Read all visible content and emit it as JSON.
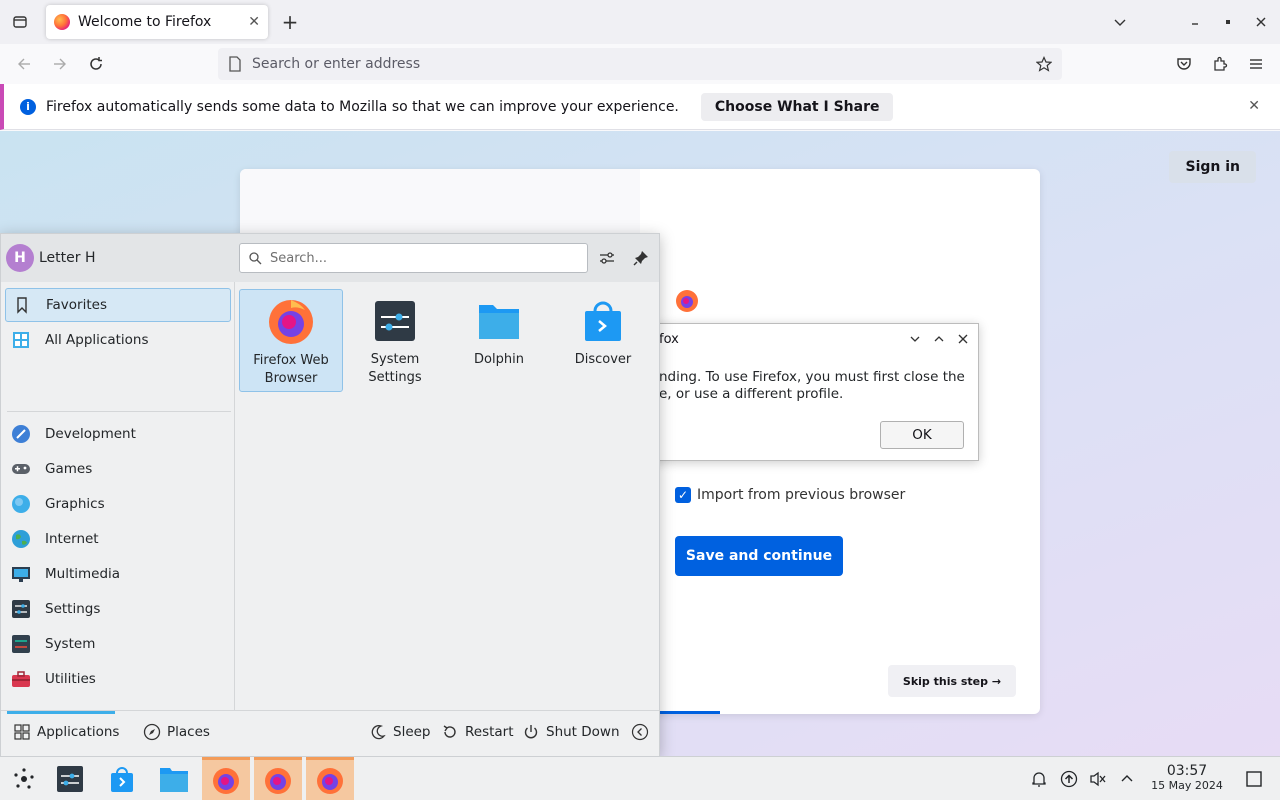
{
  "browser": {
    "tab_title": "Welcome to Firefox",
    "url_placeholder": "Search or enter address",
    "notification": {
      "message": "Firefox automatically sends some data to Mozilla so that we can improve your experience.",
      "action_label": "Choose What I Share"
    }
  },
  "page": {
    "sign_in_label": "Sign in",
    "import_label": "Import from previous browser",
    "import_checked": true,
    "save_label": "Save and continue",
    "skip_label": "Skip this step →"
  },
  "dialog": {
    "title": "fox",
    "body": "nding. To use Firefox, you must first close the e, or use a different profile.",
    "ok_label": "OK"
  },
  "kickoff": {
    "user_name": "Letter H",
    "user_initial": "H",
    "search_placeholder": "Search...",
    "sidebar": [
      {
        "label": "Favorites",
        "icon": "bookmark-icon"
      },
      {
        "label": "All Applications",
        "icon": "grid-icon"
      },
      {
        "label": "Development",
        "icon": "development-icon"
      },
      {
        "label": "Games",
        "icon": "gamepad-icon"
      },
      {
        "label": "Graphics",
        "icon": "graphics-icon"
      },
      {
        "label": "Internet",
        "icon": "globe-icon"
      },
      {
        "label": "Multimedia",
        "icon": "multimedia-icon"
      },
      {
        "label": "Settings",
        "icon": "settings-icon"
      },
      {
        "label": "System",
        "icon": "system-icon"
      },
      {
        "label": "Utilities",
        "icon": "toolbox-icon"
      }
    ],
    "favorites": [
      {
        "label": "Firefox Web Browser",
        "icon": "firefox-icon"
      },
      {
        "label": "System Settings",
        "icon": "system-settings-icon"
      },
      {
        "label": "Dolphin",
        "icon": "folder-icon"
      },
      {
        "label": "Discover",
        "icon": "shopping-bag-icon"
      }
    ],
    "footer": {
      "applications": "Applications",
      "places": "Places",
      "sleep": "Sleep",
      "restart": "Restart",
      "shutdown": "Shut Down"
    }
  },
  "taskbar": {
    "time": "03:57",
    "date": "15 May 2024"
  },
  "colors": {
    "accent": "#0061e0",
    "kde_highlight": "#3daee9",
    "notification_border": "#c94ab6"
  }
}
